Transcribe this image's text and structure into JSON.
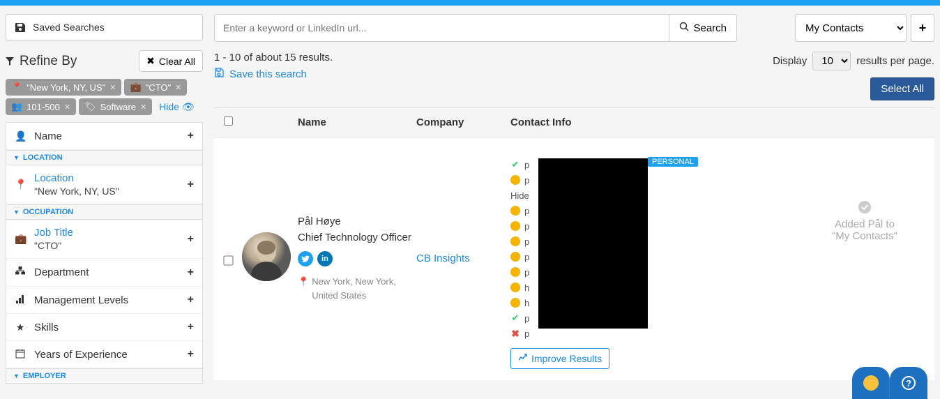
{
  "saved_searches": "Saved Searches",
  "refine": {
    "title": "Refine By",
    "clear": "Clear All",
    "hide": "Hide",
    "tags": [
      {
        "icon": "loc",
        "text": "\"New York, NY, US\""
      },
      {
        "icon": "job",
        "text": "\"CTO\""
      },
      {
        "icon": "size",
        "text": "101-500"
      },
      {
        "icon": "ind",
        "text": "Software"
      }
    ]
  },
  "sections": {
    "name": "Name",
    "location_header": "LOCATION",
    "location_label": "Location",
    "location_value": "\"New York, NY, US\"",
    "occupation_header": "OCCUPATION",
    "job_label": "Job Title",
    "job_value": "\"CTO\"",
    "department": "Department",
    "mgmt": "Management Levels",
    "skills": "Skills",
    "yoe": "Years of Experience",
    "employer_header": "EMPLOYER"
  },
  "search": {
    "placeholder": "Enter a keyword or LinkedIn url...",
    "button": "Search",
    "contacts": "My Contacts"
  },
  "results": {
    "summary": "1 - 10 of about 15 results.",
    "save": "Save this search",
    "display": "Display",
    "per_page": "results per page.",
    "page_size": "10",
    "select_all": "Select All"
  },
  "columns": {
    "name": "Name",
    "company": "Company",
    "contact": "Contact Info"
  },
  "row": {
    "name": "Pål Høye",
    "title": "Chief Technology Officer",
    "location": "New York, New York, United States",
    "company": "CB Insights",
    "personal_tag": "PERSONAL",
    "hide_text": "Hide",
    "improve": "Improve Results",
    "status_line1": "Added Pål to",
    "status_line2": "\"My Contacts\"",
    "contact_prefixes": [
      "p",
      "p",
      "",
      "p",
      "p",
      "p",
      "p",
      "p",
      "h",
      "h",
      "p",
      "p"
    ]
  }
}
